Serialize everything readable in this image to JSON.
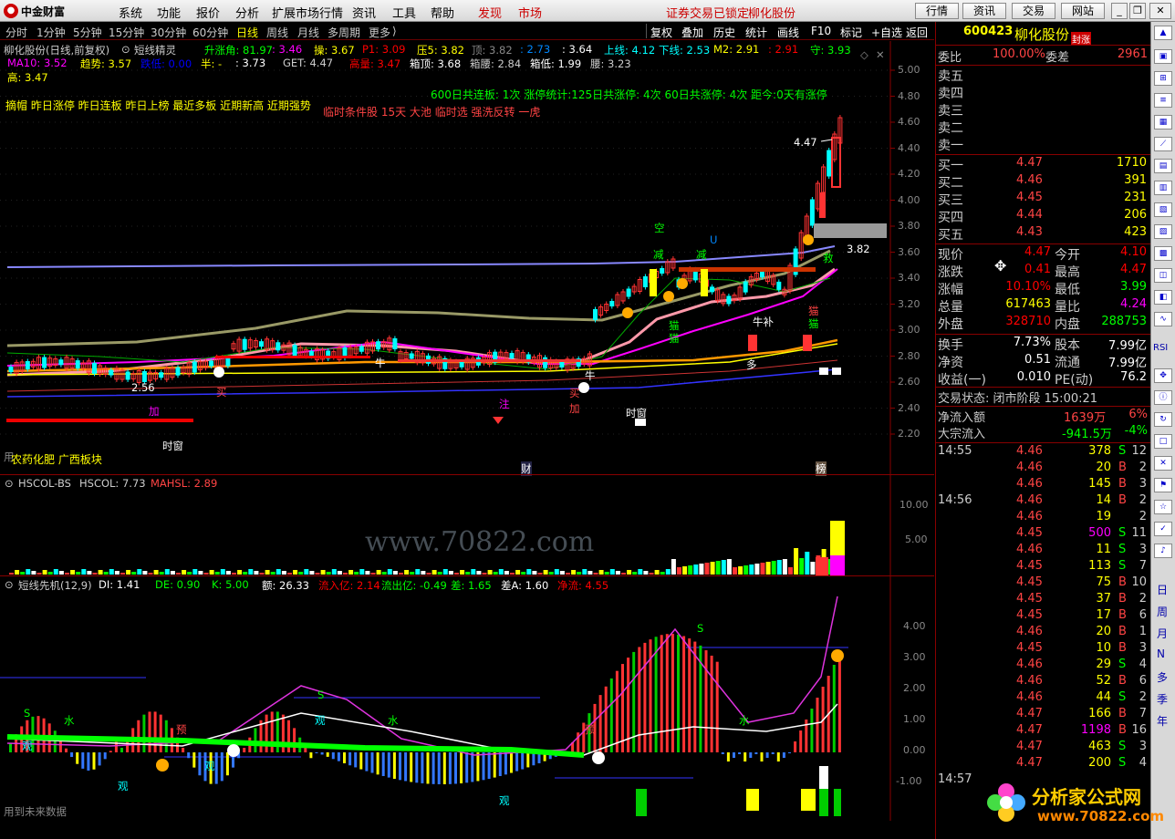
{
  "menubar": {
    "logo": "中金财富",
    "items": [
      "系统",
      "功能",
      "报价",
      "分析",
      "扩展市场行情",
      "资讯",
      "工具",
      "帮助"
    ],
    "red_items": [
      "发现",
      "市场"
    ],
    "lock_msg": "证券交易已锁定",
    "stock_title": "柳化股份",
    "buttons": [
      "行情",
      "资讯",
      "交易",
      "网站"
    ]
  },
  "periods": [
    "分时",
    "1分钟",
    "5分钟",
    "15分钟",
    "30分钟",
    "60分钟",
    "日线",
    "周线",
    "月线",
    "多周期",
    "更多"
  ],
  "active_period": "日线",
  "tools": [
    "复权",
    "叠加",
    "历史",
    "统计",
    "画线",
    "F10",
    "标记",
    "+自选",
    "返回"
  ],
  "main": {
    "title": "柳化股份(日线,前复权)",
    "indicator": "短线精灵",
    "l1": [
      {
        "t": "升涨角: 81.97",
        "c": "#0f0"
      },
      {
        "t": ": 3.46",
        "c": "#f0f"
      },
      {
        "t": "操: 3.67",
        "c": "#ff0"
      },
      {
        "t": "P1: 3.09",
        "c": "#f00"
      },
      {
        "t": "压5: 3.82",
        "c": "#ff0"
      },
      {
        "t": "顶: 3.82",
        "c": "#888"
      },
      {
        "t": ": 2.73",
        "c": "#08f"
      },
      {
        "t": ": 3.64",
        "c": "#fff"
      },
      {
        "t": "上线: 4.12",
        "c": "#0ff"
      },
      {
        "t": "下线: 2.53",
        "c": "#0ff"
      },
      {
        "t": "M2: 2.91",
        "c": "#ff0"
      },
      {
        "t": ": 2.91",
        "c": "#f00"
      },
      {
        "t": "守: 3.93",
        "c": "#0f0"
      }
    ],
    "l2": [
      {
        "t": "MA10: 3.52",
        "c": "#f0f"
      },
      {
        "t": "趋势: 3.57",
        "c": "#ff0"
      },
      {
        "t": "跌低: 0.00",
        "c": "#00f"
      },
      {
        "t": "半: -",
        "c": "#ff0"
      },
      {
        "t": ": 3.73",
        "c": "#fff"
      },
      {
        "t": "GET: 4.47",
        "c": "#ccc"
      },
      {
        "t": "高量: 3.47",
        "c": "#f00"
      },
      {
        "t": "箱顶: 3.68",
        "c": "#fff"
      },
      {
        "t": "箱腰: 2.84",
        "c": "#ccc"
      },
      {
        "t": "箱低: 1.99",
        "c": "#fff"
      },
      {
        "t": "腰: 3.23",
        "c": "#ccc"
      }
    ],
    "l3": "高: 3.47",
    "tags_yellow": "摘帽 昨日涨停 昨日连板 昨日上榜 最近多板 近期新高 近期强势",
    "stats_green": "600日共连板: 1次    涨停统计:125日共涨停: 4次    60日共涨停: 4次    距今:0天有涨停",
    "tags_red": "临时条件股 15天 大池 临时选 强洗反转 一虎",
    "sector": "农药化肥 广西板块",
    "price_ticks": [
      "5.00",
      "4.80",
      "4.60",
      "4.40",
      "4.20",
      "4.00",
      "3.80",
      "3.60",
      "3.40",
      "3.20",
      "3.00",
      "2.80",
      "2.60",
      "2.40",
      "2.20"
    ],
    "high_label": "4.47",
    "low_label": "2.56",
    "tip_label": "3.82",
    "marks": {
      "kong": "空",
      "jian1": "减",
      "jian2": "减",
      "u": "U",
      "jiu": "救",
      "mao1": "猫",
      "mao2": "猫",
      "mao3": "猫",
      "mao4": "猫",
      "niubu": "牛补",
      "niu1": "牛",
      "niu2": "牛",
      "mai": "买",
      "jia1": "加",
      "jia2": "加",
      "zhu": "注",
      "duo": "多",
      "shichuang1": "时窗",
      "shichuang2": "时窗",
      "cai": "财",
      "bang": "榜",
      "use": "用"
    }
  },
  "vol": {
    "name": "HSCOL-BS",
    "v1": "HSCOL: 7.73",
    "v2": "MAHSL: 2.89",
    "ticks": [
      "10.00",
      "5.00"
    ]
  },
  "osc": {
    "name": "短线先机(12,9)",
    "vals": [
      {
        "t": "DI: 1.41",
        "c": "#fff"
      },
      {
        "t": "DE: 0.90",
        "c": "#0f0"
      },
      {
        "t": "K: 5.00",
        "c": "#0f0"
      },
      {
        "t": "额: 26.33",
        "c": "#fff"
      },
      {
        "t": "流入亿: 2.14",
        "c": "#f00"
      },
      {
        "t": "流出亿: -0.49",
        "c": "#0f0"
      },
      {
        "t": "差: 1.65",
        "c": "#0f0"
      },
      {
        "t": "差A: 1.60",
        "c": "#fff"
      },
      {
        "t": "净流: 4.55",
        "c": "#f00"
      }
    ],
    "ticks": [
      "4.00",
      "3.00",
      "2.00",
      "1.00",
      "0.00",
      "-1.00"
    ],
    "future_note": "用到未来数据",
    "marks": {
      "s1": "S",
      "s2": "S",
      "s3": "S",
      "water1": "水",
      "water2": "水",
      "water3": "水",
      "yu1": "预",
      "yu2": "预",
      "guan1": "观",
      "guan2": "观",
      "guan3": "观",
      "guan4": "观",
      "guan5": "观"
    }
  },
  "watermark": "www.70822.com",
  "right": {
    "code": "600423",
    "name": "柳化股份",
    "tag": "封涨",
    "weibi_label": "委比",
    "weibi": "100.00%",
    "weicha_label": "委差",
    "weicha": "2961",
    "sells": [
      "卖五",
      "卖四",
      "卖三",
      "卖二",
      "卖一"
    ],
    "buys": [
      {
        "l": "买一",
        "p": "4.47",
        "v": "1710"
      },
      {
        "l": "买二",
        "p": "4.46",
        "v": "391"
      },
      {
        "l": "买三",
        "p": "4.45",
        "v": "231"
      },
      {
        "l": "买四",
        "p": "4.44",
        "v": "206"
      },
      {
        "l": "买五",
        "p": "4.43",
        "v": "423"
      }
    ],
    "quote": [
      {
        "l1": "现价",
        "v1": "4.47",
        "c1": "#f00",
        "l2": "今开",
        "v2": "4.10",
        "c2": "#f00"
      },
      {
        "l1": "涨跌",
        "v1": "0.41",
        "c1": "#f00",
        "l2": "最高",
        "v2": "4.47",
        "c2": "#f00"
      },
      {
        "l1": "涨幅",
        "v1": "10.10%",
        "c1": "#f00",
        "l2": "最低",
        "v2": "3.99",
        "c2": "#0f0"
      },
      {
        "l1": "总量",
        "v1": "617463",
        "c1": "#ff0",
        "l2": "量比",
        "v2": "4.24",
        "c2": "#f0f"
      },
      {
        "l1": "外盘",
        "v1": "328710",
        "c1": "#f00",
        "l2": "内盘",
        "v2": "288753",
        "c2": "#0f0"
      }
    ],
    "fund": [
      {
        "l1": "换手",
        "v1": "7.73%",
        "l2": "股本",
        "v2": "7.99亿"
      },
      {
        "l1": "净资",
        "v1": "0.51",
        "l2": "流通",
        "v2": "7.99亿"
      },
      {
        "l1": "收益(一)",
        "v1": "0.010",
        "l2": "PE(动)",
        "v2": "76.2"
      }
    ],
    "state_label": "交易状态: 闭市阶段 15:00:21",
    "netflow_label": "净流入额",
    "netflow": "1639万",
    "netflow_pct": "6%",
    "bigflow_label": "大宗流入",
    "bigflow": "-941.5万",
    "bigflow_pct": "-4%",
    "ticks": [
      {
        "t": "14:55",
        "p": "4.46",
        "v": "378",
        "bs": "S",
        "n": "12"
      },
      {
        "t": "",
        "p": "4.46",
        "v": "20",
        "bs": "B",
        "n": "2"
      },
      {
        "t": "",
        "p": "4.46",
        "v": "145",
        "bs": "B",
        "n": "3"
      },
      {
        "t": "14:56",
        "p": "4.46",
        "v": "14",
        "bs": "B",
        "n": "2"
      },
      {
        "t": "",
        "p": "4.46",
        "v": "19",
        "bs": "",
        "n": "2"
      },
      {
        "t": "",
        "p": "4.45",
        "v": "500",
        "bs": "S",
        "n": "11"
      },
      {
        "t": "",
        "p": "4.46",
        "v": "11",
        "bs": "S",
        "n": "3"
      },
      {
        "t": "",
        "p": "4.45",
        "v": "113",
        "bs": "S",
        "n": "7"
      },
      {
        "t": "",
        "p": "4.45",
        "v": "75",
        "bs": "B",
        "n": "10"
      },
      {
        "t": "",
        "p": "4.45",
        "v": "37",
        "bs": "B",
        "n": "2"
      },
      {
        "t": "",
        "p": "4.45",
        "v": "17",
        "bs": "B",
        "n": "6"
      },
      {
        "t": "",
        "p": "4.46",
        "v": "20",
        "bs": "B",
        "n": "1"
      },
      {
        "t": "",
        "p": "4.45",
        "v": "10",
        "bs": "B",
        "n": "3"
      },
      {
        "t": "",
        "p": "4.46",
        "v": "29",
        "bs": "S",
        "n": "4"
      },
      {
        "t": "",
        "p": "4.46",
        "v": "52",
        "bs": "B",
        "n": "6"
      },
      {
        "t": "",
        "p": "4.46",
        "v": "44",
        "bs": "S",
        "n": "2"
      },
      {
        "t": "",
        "p": "4.47",
        "v": "166",
        "bs": "B",
        "n": "7"
      },
      {
        "t": "",
        "p": "4.47",
        "v": "1198",
        "bs": "B",
        "n": "16"
      },
      {
        "t": "",
        "p": "4.47",
        "v": "463",
        "bs": "S",
        "n": "3"
      },
      {
        "t": "",
        "p": "4.47",
        "v": "200",
        "bs": "S",
        "n": "4"
      },
      {
        "t": "14:57",
        "p": "",
        "v": "",
        "bs": "",
        "n": ""
      }
    ]
  },
  "sidebar_labels": [
    "RSI",
    "日",
    "周",
    "月",
    "多",
    "季",
    "年"
  ],
  "promo": {
    "name": "分析家公式网",
    "url": "www.70822.com"
  }
}
